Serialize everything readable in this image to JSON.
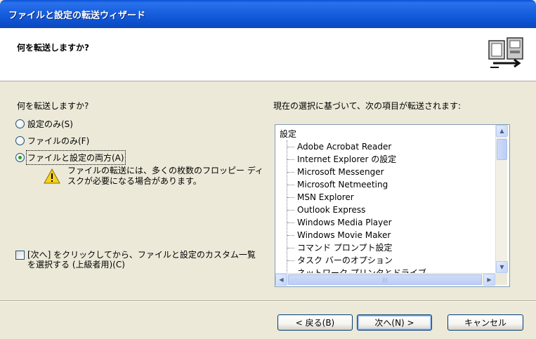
{
  "window": {
    "title": "ファイルと設定の転送ウィザード"
  },
  "header": {
    "heading": "何を転送しますか?"
  },
  "left": {
    "question": "何を転送しますか?",
    "options": [
      {
        "label": "設定のみ(S)",
        "checked": false
      },
      {
        "label": "ファイルのみ(F)",
        "checked": false
      },
      {
        "label": "ファイルと設定の両方(A)",
        "checked": true
      }
    ],
    "warning": "ファイルの転送には、多くの枚数のフロッピー ディスクが必要になる場合があります。",
    "custom_checkbox": {
      "label": "[次へ] をクリックしてから、ファイルと設定のカスタム一覧を選択する (上級者用)(C)",
      "checked": false
    }
  },
  "right": {
    "title": "現在の選択に基づいて、次の項目が転送されます:",
    "tree_root": "設定",
    "items": [
      "Adobe Acrobat Reader",
      "Internet Explorer の設定",
      "Microsoft Messenger",
      "Microsoft Netmeeting",
      "MSN Explorer",
      "Outlook Express",
      "Windows Media Player",
      "Windows Movie Maker",
      "コマンド プロンプト設定",
      "タスク バーのオプション",
      "ネットワーク プリンタとドライブ"
    ]
  },
  "buttons": {
    "back": "< 戻る(B)",
    "next": "次へ(N) >",
    "cancel": "キャンセル"
  },
  "colors": {
    "titlebar": "#0a4fd6",
    "dialog_bg": "#ece9d8",
    "radio_dot": "#21a121"
  }
}
